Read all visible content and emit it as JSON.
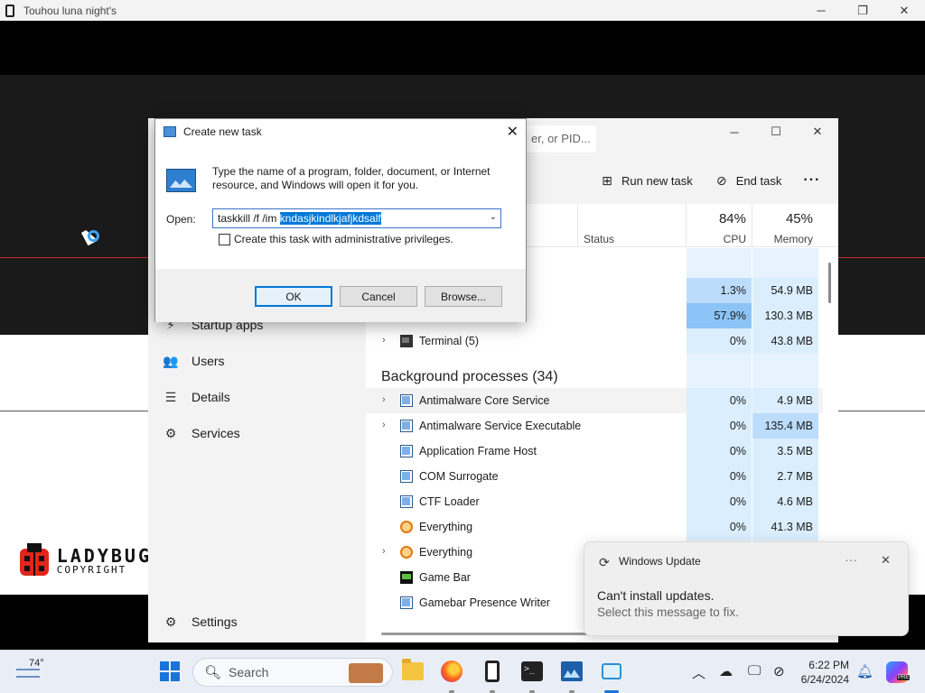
{
  "game_window": {
    "title": "Touhou luna night's",
    "controls": [
      "─",
      "❐",
      "✕"
    ],
    "logo": {
      "line1": "LADYBUG",
      "line2": "COPYRIGHT"
    }
  },
  "task_manager": {
    "search_placeholder": "er, or PID...",
    "toolbar": {
      "run_new_task": "Run new task",
      "end_task": "End task",
      "more": "···"
    },
    "nav": {
      "startup_apps": "Startup apps",
      "users": "Users",
      "details": "Details",
      "services": "Services",
      "settings": "Settings"
    },
    "columns": {
      "status": "Status",
      "cpu_pct": "84%",
      "cpu_label": "CPU",
      "mem_pct": "45%",
      "mem_label": "Memory"
    },
    "app_rows": [
      {
        "name": "",
        "cpu": "1.3%",
        "mem": "54.9 MB"
      },
      {
        "name": "",
        "cpu": "57.9%",
        "mem": "130.3 MB"
      },
      {
        "name": "Terminal (5)",
        "cpu": "0%",
        "mem": "43.8 MB"
      }
    ],
    "background_section": "Background processes (34)",
    "bg_rows": [
      {
        "name": "Antimalware Core Service",
        "cpu": "0%",
        "mem": "4.9 MB",
        "expand": true
      },
      {
        "name": "Antimalware Service Executable",
        "cpu": "0%",
        "mem": "135.4 MB",
        "expand": true
      },
      {
        "name": "Application Frame Host",
        "cpu": "0%",
        "mem": "3.5 MB",
        "expand": false
      },
      {
        "name": "COM Surrogate",
        "cpu": "0%",
        "mem": "2.7 MB",
        "expand": false
      },
      {
        "name": "CTF Loader",
        "cpu": "0%",
        "mem": "4.6 MB",
        "expand": false
      },
      {
        "name": "Everything",
        "cpu": "0%",
        "mem": "41.3 MB",
        "expand": false
      },
      {
        "name": "Everything",
        "cpu": "",
        "mem": "",
        "expand": true
      },
      {
        "name": "Game Bar",
        "cpu": "",
        "mem": "",
        "expand": false
      },
      {
        "name": "Gamebar Presence Writer",
        "cpu": "",
        "mem": "",
        "expand": false
      }
    ],
    "colors": {
      "heat_low": "#dbeefd",
      "heat_mid": "#bcdcfb",
      "heat_high": "#8cc4f7",
      "hover_row": "#f3f3f3"
    }
  },
  "dialog": {
    "title": "Create new task",
    "description": "Type the name of a program, folder, document, or Internet resource, and Windows will open it for you.",
    "open_label": "Open:",
    "input_prefix": "taskkill /f /im ",
    "input_selected": "kndasjkindlkjafjkdsalf",
    "admin_checkbox": "Create this task with administrative privileges.",
    "ok": "OK",
    "cancel": "Cancel",
    "browse": "Browse..."
  },
  "toast": {
    "app": "Windows Update",
    "title": "Can't install updates.",
    "body": "Select this message to fix."
  },
  "taskbar": {
    "temperature": "74°",
    "search": "Search",
    "time": "6:22 PM",
    "date": "6/24/2024",
    "copilot_badge": "PRE"
  }
}
